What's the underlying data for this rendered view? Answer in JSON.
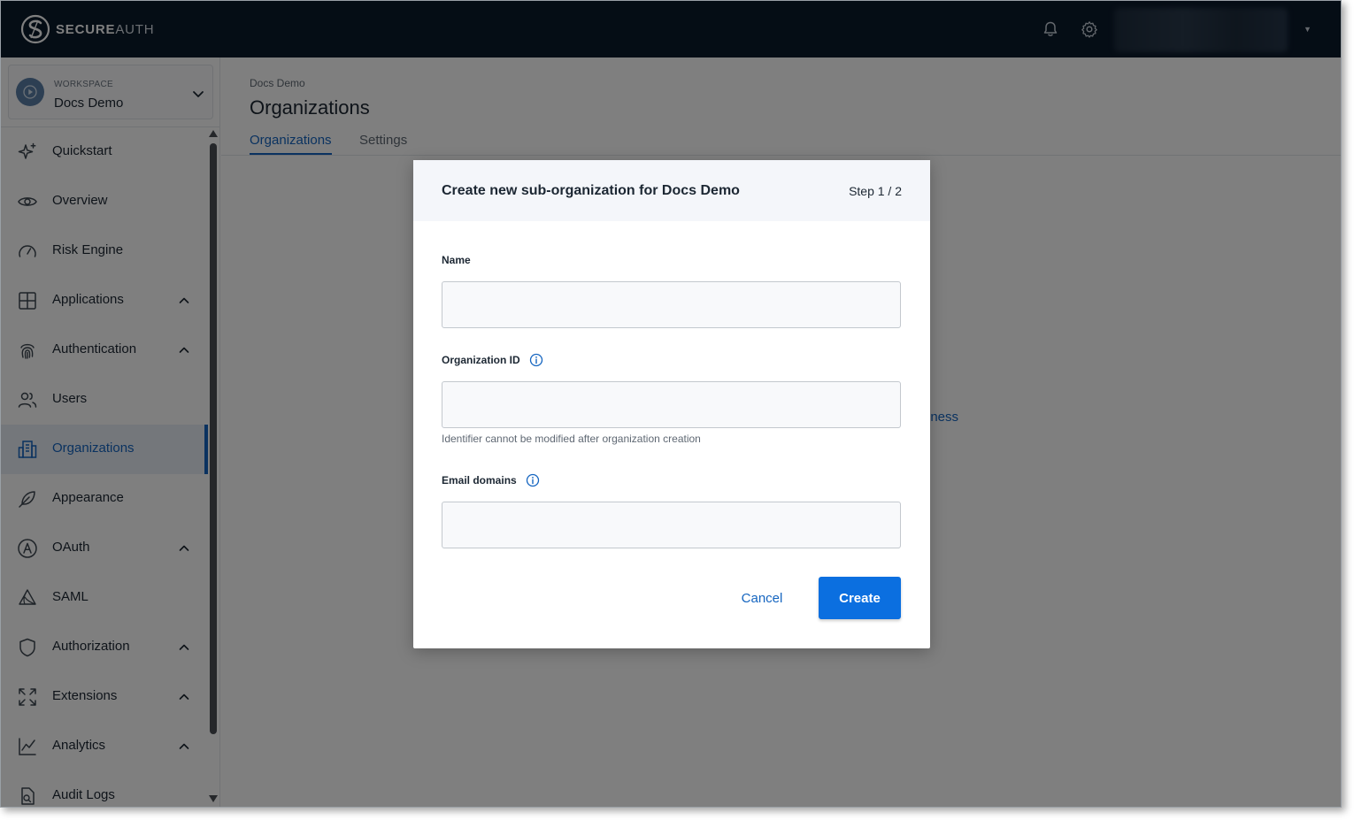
{
  "app": {
    "brand_bold": "SECURE",
    "brand_light": "AUTH"
  },
  "topbar": {
    "icons": [
      "bell-icon",
      "gear-icon",
      "caret-down-icon"
    ]
  },
  "workspace": {
    "label": "WORKSPACE",
    "name": "Docs Demo"
  },
  "sidebar": {
    "items": [
      {
        "label": "Quickstart",
        "icon": "sparkle-icon",
        "expandable": false
      },
      {
        "label": "Overview",
        "icon": "eye-icon",
        "expandable": false
      },
      {
        "label": "Risk Engine",
        "icon": "gauge-icon",
        "expandable": false
      },
      {
        "label": "Applications",
        "icon": "grid-icon",
        "expandable": true
      },
      {
        "label": "Authentication",
        "icon": "fingerprint-icon",
        "expandable": true
      },
      {
        "label": "Users",
        "icon": "users-icon",
        "expandable": false
      },
      {
        "label": "Organizations",
        "icon": "building-icon",
        "expandable": false,
        "active": true
      },
      {
        "label": "Appearance",
        "icon": "feather-icon",
        "expandable": false
      },
      {
        "label": "OAuth",
        "icon": "oauth-icon",
        "expandable": true
      },
      {
        "label": "SAML",
        "icon": "saml-icon",
        "expandable": false
      },
      {
        "label": "Authorization",
        "icon": "shield-icon",
        "expandable": true
      },
      {
        "label": "Extensions",
        "icon": "expand-icon",
        "expandable": true
      },
      {
        "label": "Analytics",
        "icon": "line-chart-icon",
        "expandable": true
      },
      {
        "label": "Audit Logs",
        "icon": "document-search-icon",
        "expandable": false
      }
    ]
  },
  "main": {
    "breadcrumb": "Docs Demo",
    "title": "Organizations",
    "tabs": [
      {
        "label": "Organizations",
        "active": true
      },
      {
        "label": "Settings",
        "active": false
      }
    ],
    "peek_text": "iness"
  },
  "modal": {
    "title": "Create new sub-organization for Docs Demo",
    "step": "Step 1 / 2",
    "fields": {
      "name": {
        "label": "Name",
        "value": "",
        "placeholder": ""
      },
      "org_id": {
        "label": "Organization ID",
        "value": "",
        "placeholder": "",
        "help": "Identifier cannot be modified after organization creation"
      },
      "email_domains": {
        "label": "Email domains",
        "value": "",
        "placeholder": ""
      }
    },
    "cancel_label": "Cancel",
    "create_label": "Create"
  },
  "colors": {
    "topbar": "#0b1a2b",
    "accent": "#1565c0",
    "primary_button": "#0b6fe0"
  }
}
